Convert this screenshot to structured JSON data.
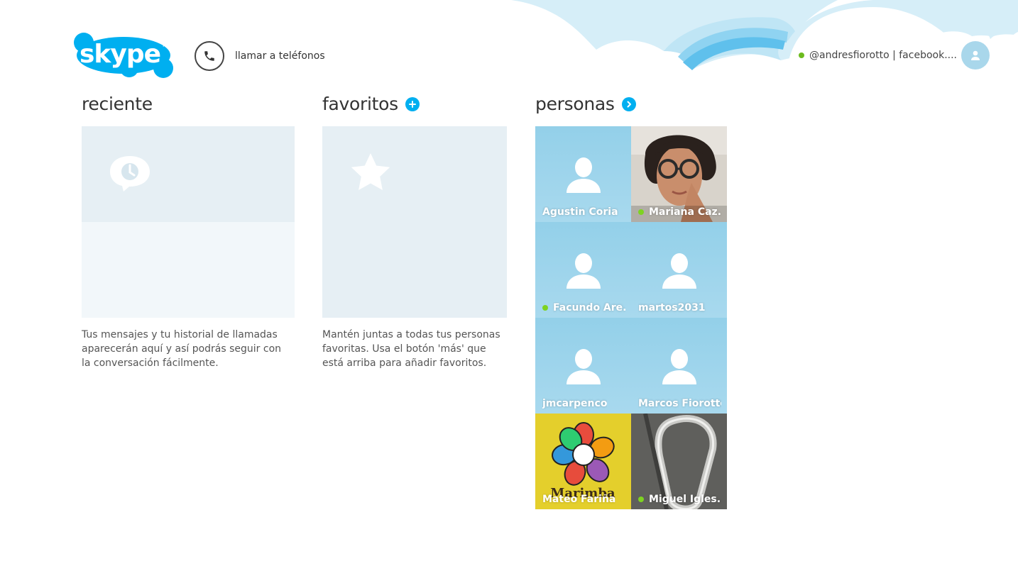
{
  "header": {
    "call_label": "llamar a teléfonos",
    "account_name": "@andresfiorotto | facebook....",
    "account_status": "online"
  },
  "sections": {
    "recent": {
      "title": "reciente",
      "description": "Tus mensajes y tu historial de llamadas aparecerán aquí y así podrás seguir con la conversación fácilmente."
    },
    "favorites": {
      "title": "favoritos",
      "description": "Mantén juntas a todas tus personas favoritas. Usa el botón 'más' que está arriba para añadir favoritos."
    },
    "people": {
      "title": "personas"
    }
  },
  "contacts": [
    {
      "name": "Agustin Coria",
      "online": false,
      "avatar": "default"
    },
    {
      "name": "Mariana Caz...",
      "online": true,
      "avatar": "photo-woman-glasses"
    },
    {
      "name": "Facundo Are...",
      "online": true,
      "avatar": "default"
    },
    {
      "name": "martos2031",
      "online": false,
      "avatar": "default"
    },
    {
      "name": "jmcarpenco",
      "online": false,
      "avatar": "default"
    },
    {
      "name": "Marcos Fiorotto",
      "online": false,
      "avatar": "default"
    },
    {
      "name": "Mateo Fariña",
      "online": false,
      "avatar": "photo-flower"
    },
    {
      "name": "Miguel Igles...",
      "online": true,
      "avatar": "photo-carabiner"
    }
  ],
  "photo_text": {
    "flower_caption": "Marimba"
  },
  "colors": {
    "brand": "#00aff0",
    "online": "#7ed321",
    "tile_bg": "#e6eff4",
    "person_tile": "#9fd5ec"
  }
}
